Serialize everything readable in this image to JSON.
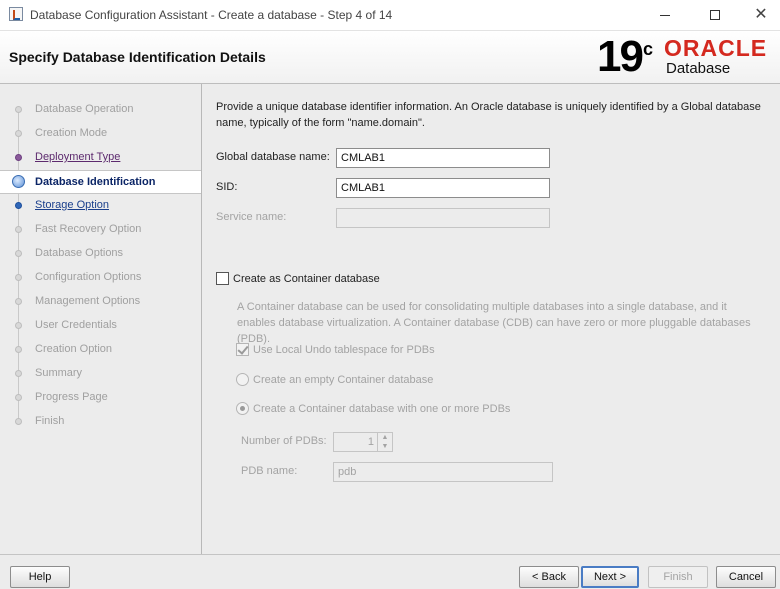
{
  "window": {
    "title": "Database Configuration Assistant - Create a database - Step 4 of 14",
    "minimize_icon": "minimize-icon",
    "maximize_icon": "maximize-icon",
    "close_icon": "close-icon"
  },
  "header": {
    "page_title": "Specify Database Identification Details",
    "version_number": "19",
    "version_suffix": "c",
    "brand": "ORACLE",
    "product": "Database"
  },
  "sidebar": {
    "steps": [
      {
        "label": "Database Operation",
        "state": "disabled"
      },
      {
        "label": "Creation Mode",
        "state": "disabled"
      },
      {
        "label": "Deployment Type",
        "state": "visited"
      },
      {
        "label": "Database Identification",
        "state": "current"
      },
      {
        "label": "Storage Option",
        "state": "link"
      },
      {
        "label": "Fast Recovery Option",
        "state": "disabled"
      },
      {
        "label": "Database Options",
        "state": "disabled"
      },
      {
        "label": "Configuration Options",
        "state": "disabled"
      },
      {
        "label": "Management Options",
        "state": "disabled"
      },
      {
        "label": "User Credentials",
        "state": "disabled"
      },
      {
        "label": "Creation Option",
        "state": "disabled"
      },
      {
        "label": "Summary",
        "state": "disabled"
      },
      {
        "label": "Progress Page",
        "state": "disabled"
      },
      {
        "label": "Finish",
        "state": "disabled"
      }
    ]
  },
  "main": {
    "intro": "Provide a unique database identifier information. An Oracle database is uniquely identified by a Global database name, typically of the form \"name.domain\".",
    "global_db_name_label": "Global database name:",
    "global_db_name_value": "CMLAB1",
    "sid_label": "SID:",
    "sid_value": "CMLAB1",
    "service_name_label": "Service name:",
    "service_name_value": "",
    "container_checkbox_label": "Create as Container database",
    "container_checked": false,
    "container_description": "A Container database can be used for consolidating multiple databases into a single database, and it enables database virtualization. A Container database (CDB) can have zero or more pluggable databases (PDB).",
    "local_undo_label": "Use Local Undo tablespace for PDBs",
    "local_undo_checked": true,
    "empty_container_label": "Create an empty Container database",
    "with_pdbs_label": "Create a Container database with one or more PDBs",
    "num_pdbs_label": "Number of PDBs:",
    "num_pdbs_value": "1",
    "pdb_name_label": "PDB name:",
    "pdb_name_value": "pdb"
  },
  "buttons": {
    "help": "Help",
    "back": "< Back",
    "next": "Next >",
    "finish": "Finish",
    "cancel": "Cancel"
  },
  "colors": {
    "brand_red": "#d4291f",
    "current_step_text": "#0b2566",
    "link_text": "#1a3f8c",
    "visited_text": "#5d2a6e"
  }
}
